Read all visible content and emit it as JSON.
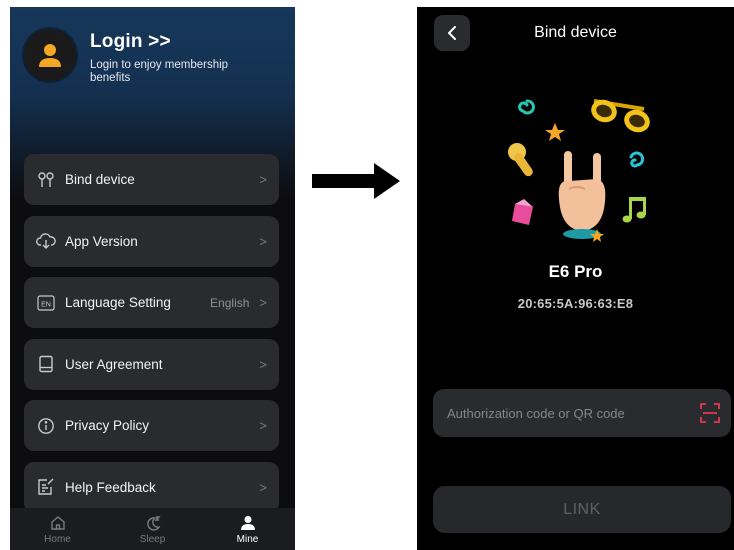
{
  "left": {
    "login_title": "Login >>",
    "login_subtitle": "Login to enjoy membership benefits",
    "menu": [
      {
        "icon": "earbuds-icon",
        "label": "Bind device",
        "value": ""
      },
      {
        "icon": "cloud-download-icon",
        "label": "App Version",
        "value": ""
      },
      {
        "icon": "language-icon",
        "icon_text": "EN",
        "label": "Language Setting",
        "value": "English"
      },
      {
        "icon": "book-icon",
        "label": "User Agreement",
        "value": ""
      },
      {
        "icon": "info-icon",
        "label": "Privacy Policy",
        "value": ""
      },
      {
        "icon": "feedback-icon",
        "label": "Help Feedback",
        "value": ""
      }
    ],
    "tabs": [
      {
        "icon": "home-icon",
        "label": "Home",
        "active": false
      },
      {
        "icon": "sleep-icon",
        "label": "Sleep",
        "active": false
      },
      {
        "icon": "person-icon",
        "label": "Mine",
        "active": true
      }
    ],
    "chevron": ">"
  },
  "right": {
    "title": "Bind device",
    "device_name": "E6 Pro",
    "mac_address": "20:65:5A:96:63:E8",
    "auth_placeholder": "Authorization code or QR code",
    "link_label": "LINK"
  },
  "colors": {
    "accent_scan": "#e8384f",
    "card_bg": "#2a2b2f",
    "hero_blue": "#16375a"
  }
}
